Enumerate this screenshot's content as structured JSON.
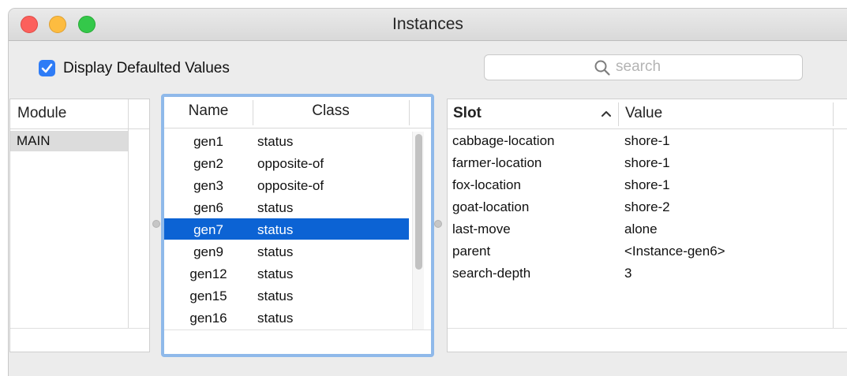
{
  "window": {
    "title": "Instances"
  },
  "options": {
    "display_defaulted_label": "Display Defaulted Values",
    "display_defaulted_checked": true
  },
  "search": {
    "placeholder": "search"
  },
  "modules": {
    "header": "Module",
    "items": [
      "MAIN"
    ]
  },
  "instances": {
    "headers": {
      "name": "Name",
      "class": "Class"
    },
    "rows": [
      {
        "name": "gen1",
        "class": "status"
      },
      {
        "name": "gen2",
        "class": "opposite-of"
      },
      {
        "name": "gen3",
        "class": "opposite-of"
      },
      {
        "name": "gen6",
        "class": "status"
      },
      {
        "name": "gen7",
        "class": "status"
      },
      {
        "name": "gen9",
        "class": "status"
      },
      {
        "name": "gen12",
        "class": "status"
      },
      {
        "name": "gen15",
        "class": "status"
      },
      {
        "name": "gen16",
        "class": "status"
      }
    ],
    "selected": "gen7"
  },
  "slots": {
    "headers": {
      "slot": "Slot",
      "value": "Value"
    },
    "sort": "ascending",
    "rows": [
      {
        "slot": "cabbage-location",
        "value": "shore-1"
      },
      {
        "slot": "farmer-location",
        "value": "shore-1"
      },
      {
        "slot": "fox-location",
        "value": "shore-1"
      },
      {
        "slot": "goat-location",
        "value": "shore-2"
      },
      {
        "slot": "last-move",
        "value": "alone"
      },
      {
        "slot": "parent",
        "value": "<Instance-gen6>"
      },
      {
        "slot": "search-depth",
        "value": "3"
      }
    ]
  },
  "colors": {
    "accent": "#2e7cf6",
    "selection": "#0c63d4",
    "focus_ring": "#8fb9ea"
  },
  "icons": {
    "search": "magnifier-icon",
    "check": "checkmark-icon",
    "sort": "chevron-up-icon"
  }
}
